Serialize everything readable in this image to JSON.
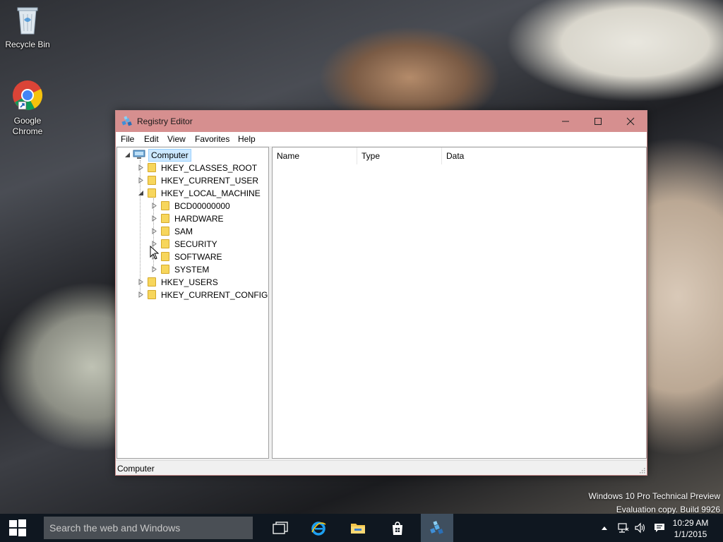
{
  "desktop": {
    "icons": [
      {
        "label": "Recycle Bin"
      },
      {
        "label": "Google\nChrome"
      }
    ],
    "watermark_line1": "Windows 10 Pro Technical Preview",
    "watermark_line2": "Evaluation copy. Build 9926"
  },
  "window": {
    "title": "Registry Editor",
    "menu": [
      "File",
      "Edit",
      "View",
      "Favorites",
      "Help"
    ],
    "tree": {
      "root": "Computer",
      "hives": [
        "HKEY_CLASSES_ROOT",
        "HKEY_CURRENT_USER",
        "HKEY_LOCAL_MACHINE",
        "HKEY_USERS",
        "HKEY_CURRENT_CONFIG"
      ],
      "hklm_children": [
        "BCD00000000",
        "HARDWARE",
        "SAM",
        "SECURITY",
        "SOFTWARE",
        "SYSTEM"
      ]
    },
    "columns": [
      "Name",
      "Type",
      "Data"
    ],
    "status": "Computer"
  },
  "taskbar": {
    "search_placeholder": "Search the web and Windows",
    "time": "10:29 AM",
    "date": "1/1/2015",
    "apps": [
      "task-view-icon",
      "internet-explorer-icon",
      "file-explorer-icon",
      "store-icon",
      "registry-editor-icon"
    ]
  },
  "colors": {
    "titlebar": "#d68f8f",
    "taskbar": "#0f1720",
    "selection": "#cce8ff"
  }
}
